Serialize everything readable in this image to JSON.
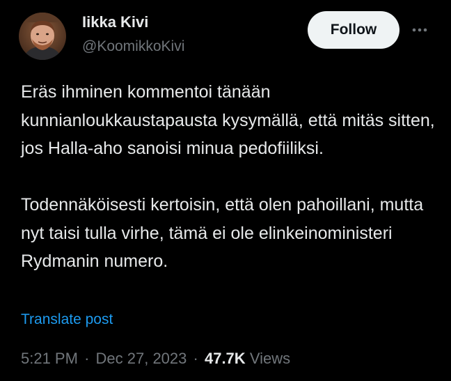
{
  "author": {
    "name": "Iikka Kivi",
    "handle": "@KoomikkoKivi"
  },
  "actions": {
    "follow_label": "Follow",
    "more_icon": "more-horizontal-icon"
  },
  "tweet": {
    "paragraphs": [
      "Eräs ihminen kommentoi tänään kunnianloukkaustapausta kysymällä, että mitäs sitten, jos Halla-aho sanoisi minua pedofiiliksi.",
      "Todennäköisesti kertoisin, että olen pahoillani, mutta nyt taisi tulla virhe, tämä ei ole elinkeinoministeri Rydmanin numero."
    ],
    "translate_label": "Translate post"
  },
  "meta": {
    "time": "5:21 PM",
    "separator": "·",
    "date": "Dec 27, 2023",
    "views_count": "47.7K",
    "views_label": "Views"
  },
  "colors": {
    "background": "#000000",
    "text": "#e7e9ea",
    "secondary": "#71767b",
    "link": "#1d9bf0",
    "button_bg": "#eff3f4"
  }
}
